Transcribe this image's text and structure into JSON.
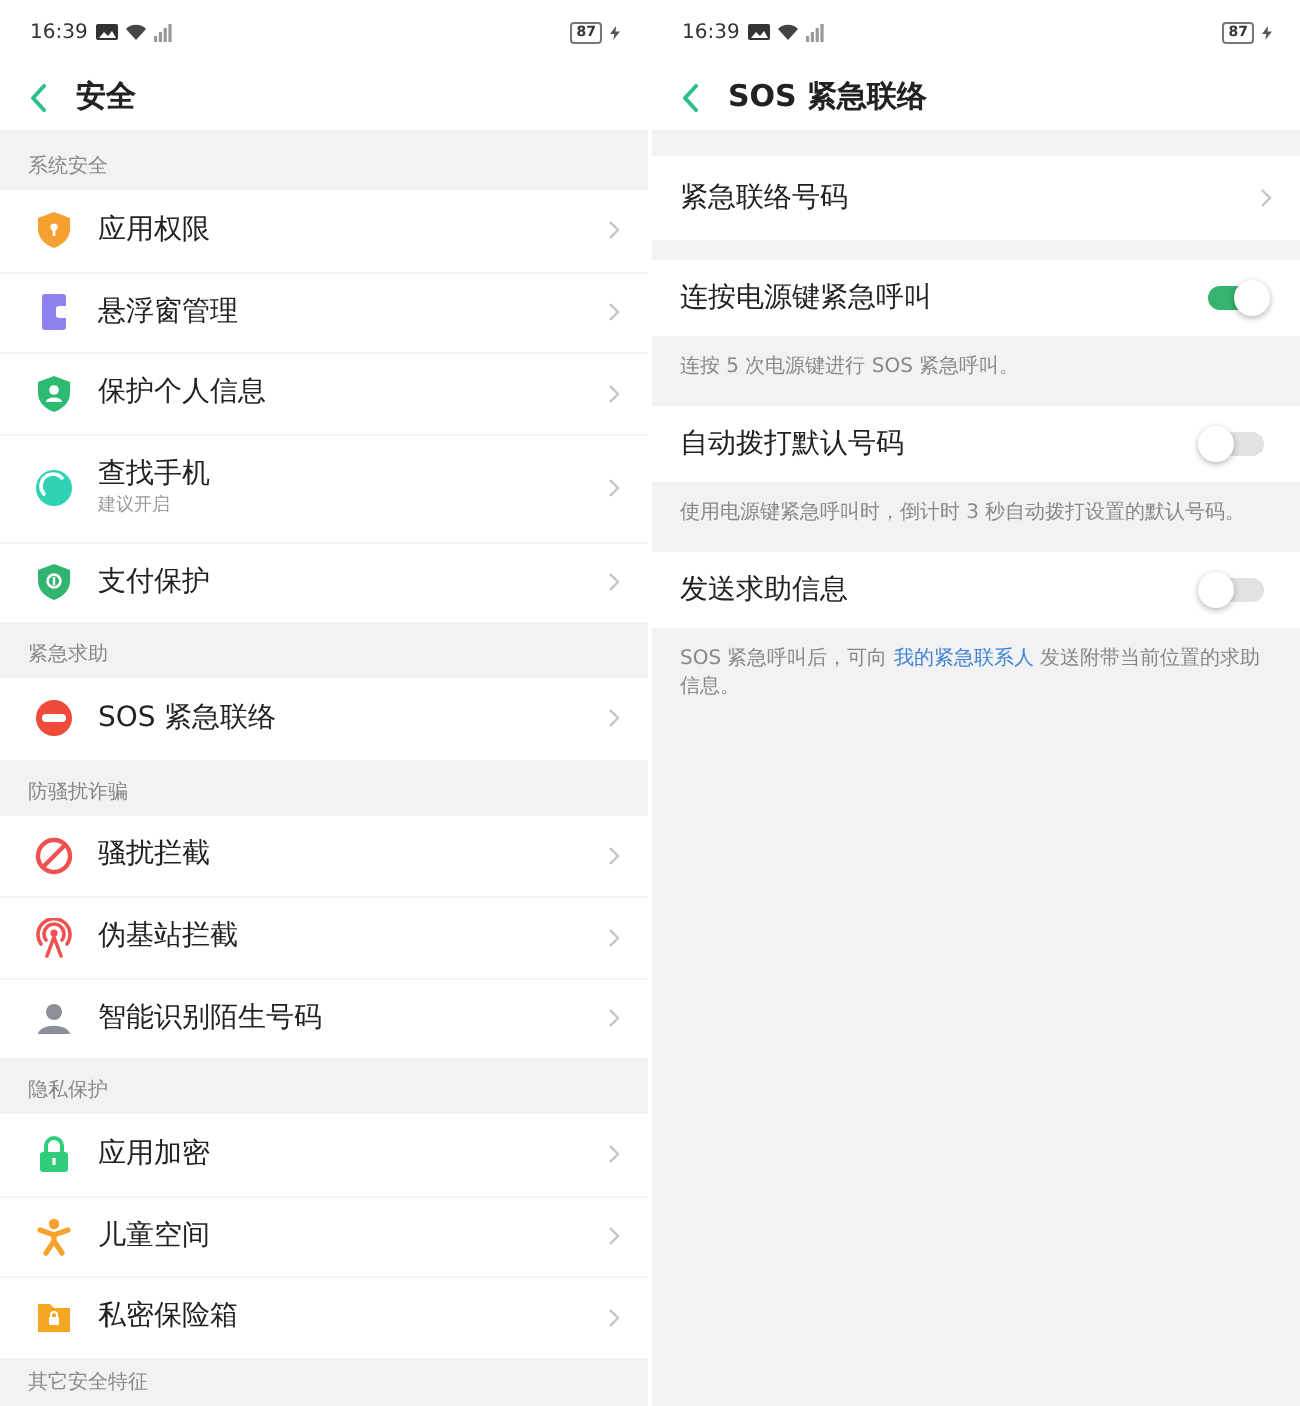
{
  "security_screen": {
    "status_bar": {
      "time": "16:39",
      "battery": "87"
    },
    "title": "安全",
    "sections": [
      {
        "title": "系统安全",
        "items": [
          {
            "label": "应用权限"
          },
          {
            "label": "悬浮窗管理"
          },
          {
            "label": "保护个人信息"
          },
          {
            "label": "查找手机",
            "subtitle": "建议开启"
          },
          {
            "label": "支付保护"
          }
        ]
      },
      {
        "title": "紧急求助",
        "items": [
          {
            "label": "SOS 紧急联络"
          }
        ]
      },
      {
        "title": "防骚扰诈骗",
        "items": [
          {
            "label": "骚扰拦截"
          },
          {
            "label": "伪基站拦截"
          },
          {
            "label": "智能识别陌生号码"
          }
        ]
      },
      {
        "title": "隐私保护",
        "items": [
          {
            "label": "应用加密"
          },
          {
            "label": "儿童空间"
          },
          {
            "label": "私密保险箱"
          }
        ]
      },
      {
        "title": "其它安全特征"
      }
    ]
  },
  "sos_screen": {
    "status_bar": {
      "time": "16:39",
      "battery": "87"
    },
    "title": "SOS 紧急联络",
    "items": [
      {
        "kind": "link",
        "label": "紧急联络号码"
      },
      {
        "kind": "toggle",
        "label": "连按电源键紧急呼叫",
        "on": true,
        "note": "连按 5 次电源键进行 SOS 紧急呼叫。"
      },
      {
        "kind": "toggle",
        "label": "自动拨打默认号码",
        "on": false,
        "note": "使用电源键紧急呼叫时，倒计时 3 秒自动拨打设置的默认号码。"
      },
      {
        "kind": "toggle",
        "label": "发送求助信息",
        "on": false,
        "note": "SOS 紧急呼叫后，可向",
        "note_link": "我的紧急联系人",
        "note_end": "发送附带当前位置的求助信息。"
      }
    ]
  }
}
